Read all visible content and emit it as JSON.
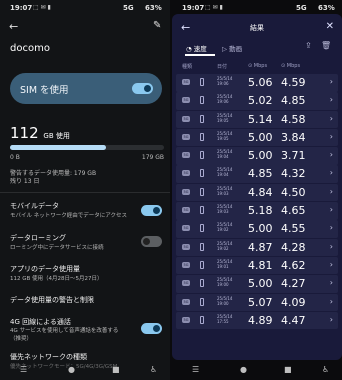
{
  "left": {
    "status": {
      "time": "19:07",
      "notifications": "⬚ ✉ ▮",
      "network": "5G",
      "battery": "63%"
    },
    "back_icon": "arrow-left-icon",
    "edit_icon": "pencil-icon",
    "title": "docomo",
    "sim_card": {
      "label": "SIM を使用",
      "enabled": true
    },
    "usage": {
      "value": "112",
      "unit": "GB 使用",
      "min_label": "0 B",
      "max_label": "179 GB",
      "fraction": 0.626,
      "warning": "警告するデータ使用量: 179 GB",
      "remaining": "残り 13 日"
    },
    "settings": [
      {
        "title": "モバイルデータ",
        "subtitle": "モバイル ネットワーク経由でデータにアクセス",
        "toggle": true,
        "on": true
      },
      {
        "title": "データローミング",
        "subtitle": "ローミング中にデータサービスに接続",
        "toggle": true,
        "on": false
      },
      {
        "title": "アプリのデータ使用量",
        "subtitle": "112 GB 使用（4月28日～5月27日）",
        "toggle": false
      },
      {
        "title": "データ使用量の警告と制限",
        "subtitle": "",
        "toggle": false
      },
      {
        "title": "4G 回線による通話",
        "subtitle": "4G サービスを使用して音声通話を改善する",
        "subtitle2": "（推奨）",
        "toggle": true,
        "on": true
      },
      {
        "title": "優先ネットワークの種類",
        "subtitle": "優先ネットワークモード：5G/4G/3G/GSM",
        "toggle": false
      }
    ],
    "nav": {
      "menu": "☰",
      "home": "●",
      "recent": "■",
      "accessibility": "♿"
    }
  },
  "right": {
    "status": {
      "time": "19:07",
      "notifications": "⬚ ✉ ▮",
      "network": "5G",
      "battery": "63%"
    },
    "back_icon": "arrow-left-icon",
    "title": "結果",
    "close_icon": "close-icon",
    "tabs": [
      {
        "label": "速度",
        "icon": "speed-icon",
        "active": true
      },
      {
        "label": "動画",
        "icon": "play-icon",
        "active": false
      }
    ],
    "toolbar_icons": [
      "share-icon",
      "trash-icon",
      "close-icon"
    ],
    "headers": {
      "type": "種類",
      "date": "日付",
      "download": "Mbps",
      "upload": "Mbps"
    },
    "rows": [
      {
        "server": "5G",
        "date1": "25/5/14",
        "date2": "19:06",
        "download": "5.06",
        "upload": "4.59"
      },
      {
        "server": "5G",
        "date1": "25/5/14",
        "date2": "19:06",
        "download": "5.02",
        "upload": "4.85"
      },
      {
        "server": "5G",
        "date1": "25/5/14",
        "date2": "19:05",
        "download": "5.14",
        "upload": "4.58"
      },
      {
        "server": "5G",
        "date1": "25/5/14",
        "date2": "19:05",
        "download": "5.00",
        "upload": "3.84"
      },
      {
        "server": "5G",
        "date1": "25/5/14",
        "date2": "19:04",
        "download": "5.00",
        "upload": "3.71"
      },
      {
        "server": "5G",
        "date1": "25/5/14",
        "date2": "19:04",
        "download": "4.85",
        "upload": "4.32"
      },
      {
        "server": "5G",
        "date1": "25/5/14",
        "date2": "19:03",
        "download": "4.84",
        "upload": "4.50"
      },
      {
        "server": "5G",
        "date1": "25/5/14",
        "date2": "19:03",
        "download": "5.18",
        "upload": "4.65"
      },
      {
        "server": "5G",
        "date1": "25/5/14",
        "date2": "19:02",
        "download": "5.00",
        "upload": "4.55"
      },
      {
        "server": "5G",
        "date1": "25/5/14",
        "date2": "19:02",
        "download": "4.87",
        "upload": "4.28"
      },
      {
        "server": "5G",
        "date1": "25/5/14",
        "date2": "19:01",
        "download": "4.81",
        "upload": "4.62"
      },
      {
        "server": "5G",
        "date1": "25/5/14",
        "date2": "19:00",
        "download": "5.00",
        "upload": "4.27"
      },
      {
        "server": "5G",
        "date1": "25/5/14",
        "date2": "19:00",
        "download": "5.07",
        "upload": "4.09"
      },
      {
        "server": "5G",
        "date1": "25/5/14",
        "date2": "17:55",
        "download": "4.89",
        "upload": "4.47"
      }
    ],
    "nav": {
      "menu": "☰",
      "home": "●",
      "recent": "■",
      "accessibility": "♿"
    }
  }
}
